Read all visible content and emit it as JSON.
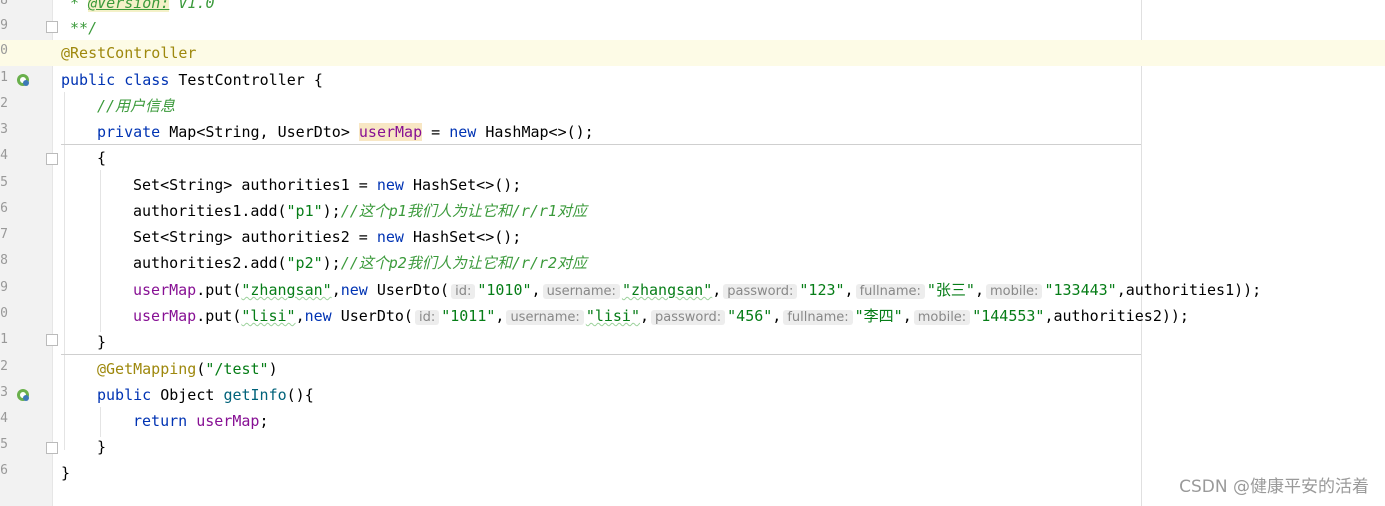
{
  "editor": {
    "line_numbers": [
      "8",
      "9",
      "0",
      "1",
      "2",
      "3",
      "4",
      "5",
      "6",
      "7",
      "8",
      "9",
      "0",
      "1",
      "2",
      "3",
      "4",
      "5",
      "6"
    ],
    "doc": {
      "prefix": " * ",
      "tag": "@Version:",
      "value": " V1.0",
      "end": " **/"
    },
    "annotation_rest": "@RestController",
    "class_decl": {
      "kw1": "public",
      "kw2": "class",
      "name": " TestController {"
    },
    "comment_userinfo": "//用户信息",
    "field_decl": {
      "kw": "private",
      "type": " Map<String, UserDto> ",
      "name": "userMap",
      "eq": " = ",
      "new": "new",
      "rest": " HashMap<>();"
    },
    "brace_open": "{",
    "set1": {
      "type": "Set<String> authorities1 = ",
      "new": "new",
      "rest": " HashSet<>();"
    },
    "add1": {
      "pre": "authorities1.add(",
      "str": "\"p1\"",
      "post": ");",
      "comment": "//这个p1我们人为让它和/r/r1对应"
    },
    "set2": {
      "type": "Set<String> authorities2 = ",
      "new": "new",
      "rest": " HashSet<>();"
    },
    "add2": {
      "pre": "authorities2.add(",
      "str": "\"p2\"",
      "post": ");",
      "comment": "//这个p2我们人为让它和/r/r2对应"
    },
    "put1": {
      "field": "userMap",
      "call": ".put(",
      "key": "\"zhangsan\"",
      "comma": ",",
      "new": "new",
      "ctor": " UserDto(",
      "hint_id": "id:",
      "v_id": "\"1010\"",
      "hint_username": "username:",
      "v_username": "\"zhangsan\"",
      "hint_password": "password:",
      "v_password": "\"123\"",
      "hint_fullname": "fullname:",
      "v_fullname": "\"张三\"",
      "hint_mobile": "mobile:",
      "v_mobile": "\"133443\"",
      "tail": ",authorities1));"
    },
    "put2": {
      "field": "userMap",
      "call": ".put(",
      "key": "\"lisi\"",
      "comma": ",",
      "new": "new",
      "ctor": " UserDto(",
      "hint_id": "id:",
      "v_id": "\"1011\"",
      "hint_username": "username:",
      "v_username": "\"lisi\"",
      "hint_password": "password:",
      "v_password": "\"456\"",
      "hint_fullname": "fullname:",
      "v_fullname": "\"李四\"",
      "hint_mobile": "mobile:",
      "v_mobile": "\"144553\"",
      "tail": ",authorities2));"
    },
    "brace_close": "}",
    "getmapping": {
      "ann": "@GetMapping",
      "open": "(",
      "str": "\"/test\"",
      "close": ")"
    },
    "method_decl": {
      "kw": "public",
      "type": " Object ",
      "name": "getInfo",
      "rest": "(){"
    },
    "return_stmt": {
      "kw": "return",
      "field": "userMap",
      "semi": ";"
    },
    "method_close": "}",
    "class_close": "}"
  },
  "watermark": "CSDN @健康平安的活着"
}
